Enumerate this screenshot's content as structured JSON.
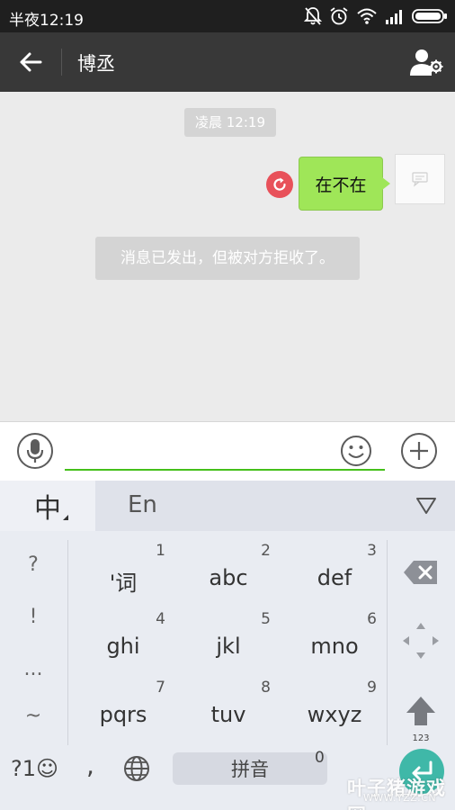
{
  "status_bar": {
    "time": "半夜12:19",
    "icons": [
      "notifications-off-icon",
      "alarm-icon",
      "wifi-icon",
      "signal-icon",
      "battery-icon"
    ]
  },
  "header": {
    "title": "博丞",
    "back_icon": "back-arrow-icon",
    "profile_icon": "contact-settings-icon"
  },
  "chat": {
    "timestamp": "凌晨 12:19",
    "messages": [
      {
        "direction": "outgoing",
        "text": "在不在",
        "status": "failed",
        "status_icon": "resend-icon"
      }
    ],
    "system_notice": "消息已发出，但被对方拒收了。"
  },
  "input_bar": {
    "value": "",
    "placeholder": "",
    "voice_icon": "microphone-icon",
    "emoji_icon": "smiley-icon",
    "more_icon": "plus-icon"
  },
  "keyboard": {
    "mode_cn": "中",
    "mode_en": "En",
    "symbols": [
      "?",
      "!",
      "...",
      "~"
    ],
    "keys": [
      {
        "num": "1",
        "label": "'词"
      },
      {
        "num": "2",
        "label": "abc"
      },
      {
        "num": "3",
        "label": "def"
      },
      {
        "num": "4",
        "label": "ghi"
      },
      {
        "num": "5",
        "label": "jkl"
      },
      {
        "num": "6",
        "label": "mno"
      },
      {
        "num": "7",
        "label": "pqrs"
      },
      {
        "num": "8",
        "label": "tuv"
      },
      {
        "num": "9",
        "label": "wxyz"
      }
    ],
    "shift_sub": "123",
    "bottom": {
      "sym": "?1☺",
      "comma": ",",
      "space": "拼音",
      "zero": "0"
    }
  },
  "watermark": {
    "text": "叶子猪游戏网",
    "url": "WWW.YZZ.CN"
  },
  "colors": {
    "title_bar": "#383838",
    "bubble": "#9fe658",
    "resend": "#e8515a",
    "input_underline": "#45c01a",
    "enter_key": "#3fb8a8"
  }
}
